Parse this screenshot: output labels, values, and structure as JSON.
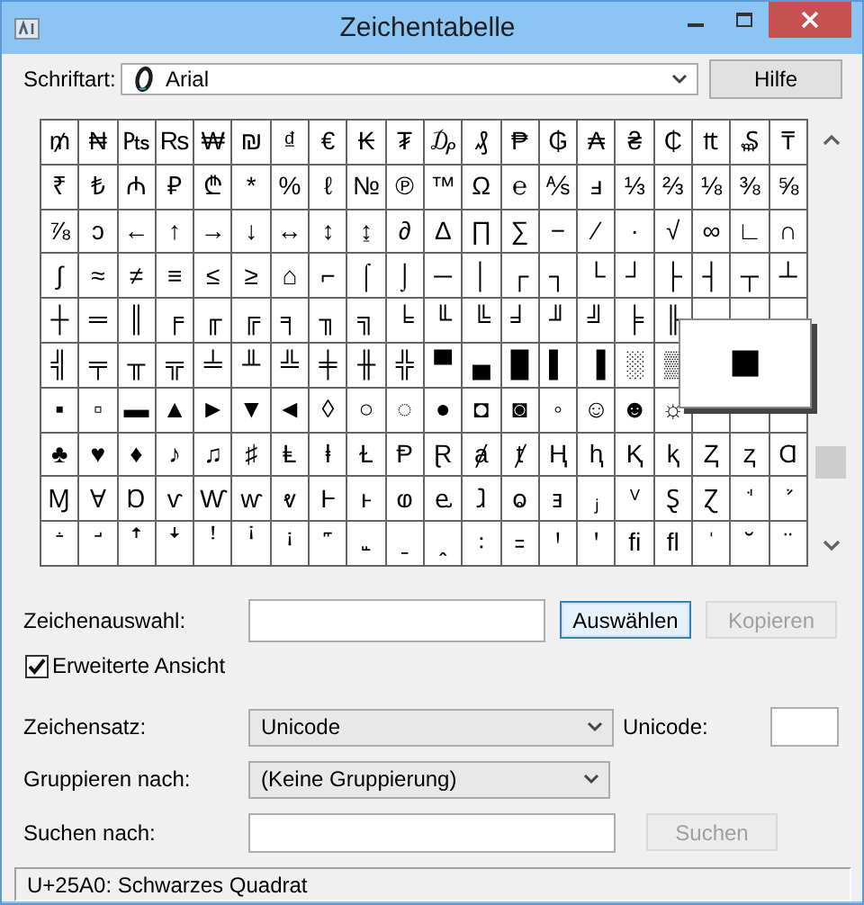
{
  "window": {
    "title": "Zeichentabelle"
  },
  "font_row": {
    "label": {
      "text": "Schriftart:"
    },
    "value": "Arial",
    "help_button": {
      "text": "Hilfe"
    }
  },
  "grid": {
    "rows": [
      [
        "₥",
        "₦",
        "₧",
        "₨",
        "₩",
        "₪",
        "₫",
        "€",
        "₭",
        "₮",
        "₯",
        "₰",
        "₱",
        "₲",
        "₳",
        "₴",
        "₵",
        "₶",
        "₷",
        "₸"
      ],
      [
        "₹",
        "₺",
        "₼",
        "₽",
        "₾",
        "*",
        "%",
        "ℓ",
        "№",
        "℗",
        "™",
        "Ω",
        "℮",
        "⅍",
        "ⅎ",
        "⅓",
        "⅔",
        "⅛",
        "⅜",
        "⅝"
      ],
      [
        "⅞",
        "ↄ",
        "←",
        "↑",
        "→",
        "↓",
        "↔",
        "↕",
        "↨",
        "∂",
        "∆",
        "∏",
        "∑",
        "−",
        "∕",
        "∙",
        "√",
        "∞",
        "∟",
        "∩"
      ],
      [
        "∫",
        "≈",
        "≠",
        "≡",
        "≤",
        "≥",
        "⌂",
        "⌐",
        "⌠",
        "⌡",
        "─",
        "│",
        "┌",
        "┐",
        "└",
        "┘",
        "├",
        "┤",
        "┬",
        "┴"
      ],
      [
        "┼",
        "═",
        "║",
        "╒",
        "╓",
        "╔",
        "╕",
        "╖",
        "╗",
        "╘",
        "╙",
        "╚",
        "╛",
        "╜",
        "╝",
        "╞",
        "╟",
        null,
        null,
        null
      ],
      [
        "╣",
        "╤",
        "╥",
        "╦",
        "╧",
        "╨",
        "╩",
        "╪",
        "╫",
        "╬",
        "▀",
        "▄",
        "█",
        "▌",
        "▐",
        "░",
        "▒",
        null,
        null,
        null
      ],
      [
        "▪",
        "▫",
        "▬",
        "▲",
        "►",
        "▼",
        "◄",
        "◊",
        "○",
        "◌",
        "●",
        "◘",
        "◙",
        "◦",
        "☺",
        "☻",
        "☼",
        null,
        null,
        null
      ],
      [
        "♣",
        "♥",
        "♦",
        "♪",
        "♫",
        "♯",
        "Ⱡ",
        "ⱡ",
        "Ɫ",
        "Ᵽ",
        "Ɽ",
        "ⱥ",
        "ⱦ",
        "Ⱨ",
        "ⱨ",
        "Ⱪ",
        "ⱪ",
        "Ⱬ",
        "ⱬ",
        "Ɑ"
      ],
      [
        "Ɱ",
        "Ɐ",
        "Ɒ",
        "ⱱ",
        "Ⱳ",
        "ⱳ",
        "ⱴ",
        "Ⱶ",
        "ⱶ",
        "ⱷ",
        "ⱸ",
        "ⱹ",
        "ⱺ",
        "ⱻ",
        "ⱼ",
        "ⱽ",
        "Ȿ",
        "Ɀ",
        "ꜗ",
        "ꜘ"
      ],
      [
        "ꜙ",
        "ꜚ",
        "ꜛ",
        "ꜜ",
        "ꜝ",
        "ꜞ",
        "ꜟ",
        "꜠",
        "꜡",
        "ˍ",
        "ꞈ",
        "꞉",
        "꞊",
        "Ꞌ",
        "ꞌ",
        "ﬁ",
        "ﬂ",
        "ˈ",
        "˘",
        "¨"
      ]
    ]
  },
  "zoom_popup": {
    "char": "■"
  },
  "selection": {
    "label": {
      "text": "Zeichenauswahl:"
    },
    "select_button": {
      "text": "Auswählen",
      "default": true,
      "disabled": false
    },
    "copy_button": {
      "text": "Kopieren",
      "default": false,
      "disabled": true
    }
  },
  "advanced_view": {
    "text": "Erweiterte Ansicht",
    "checked": true
  },
  "charset": {
    "label": {
      "text": "Zeichensatz:"
    },
    "value": "Unicode",
    "unicode_label": {
      "text": "Unicode:"
    }
  },
  "group_by": {
    "label": {
      "text": "Gruppieren nach:"
    },
    "value": "(Keine Gruppierung)"
  },
  "search": {
    "label": {
      "text": "Suchen nach:"
    },
    "button": {
      "text": "Suchen",
      "default": false,
      "disabled": true
    }
  },
  "status_bar": {
    "text": "U+25A0: Schwarzes Quadrat"
  }
}
